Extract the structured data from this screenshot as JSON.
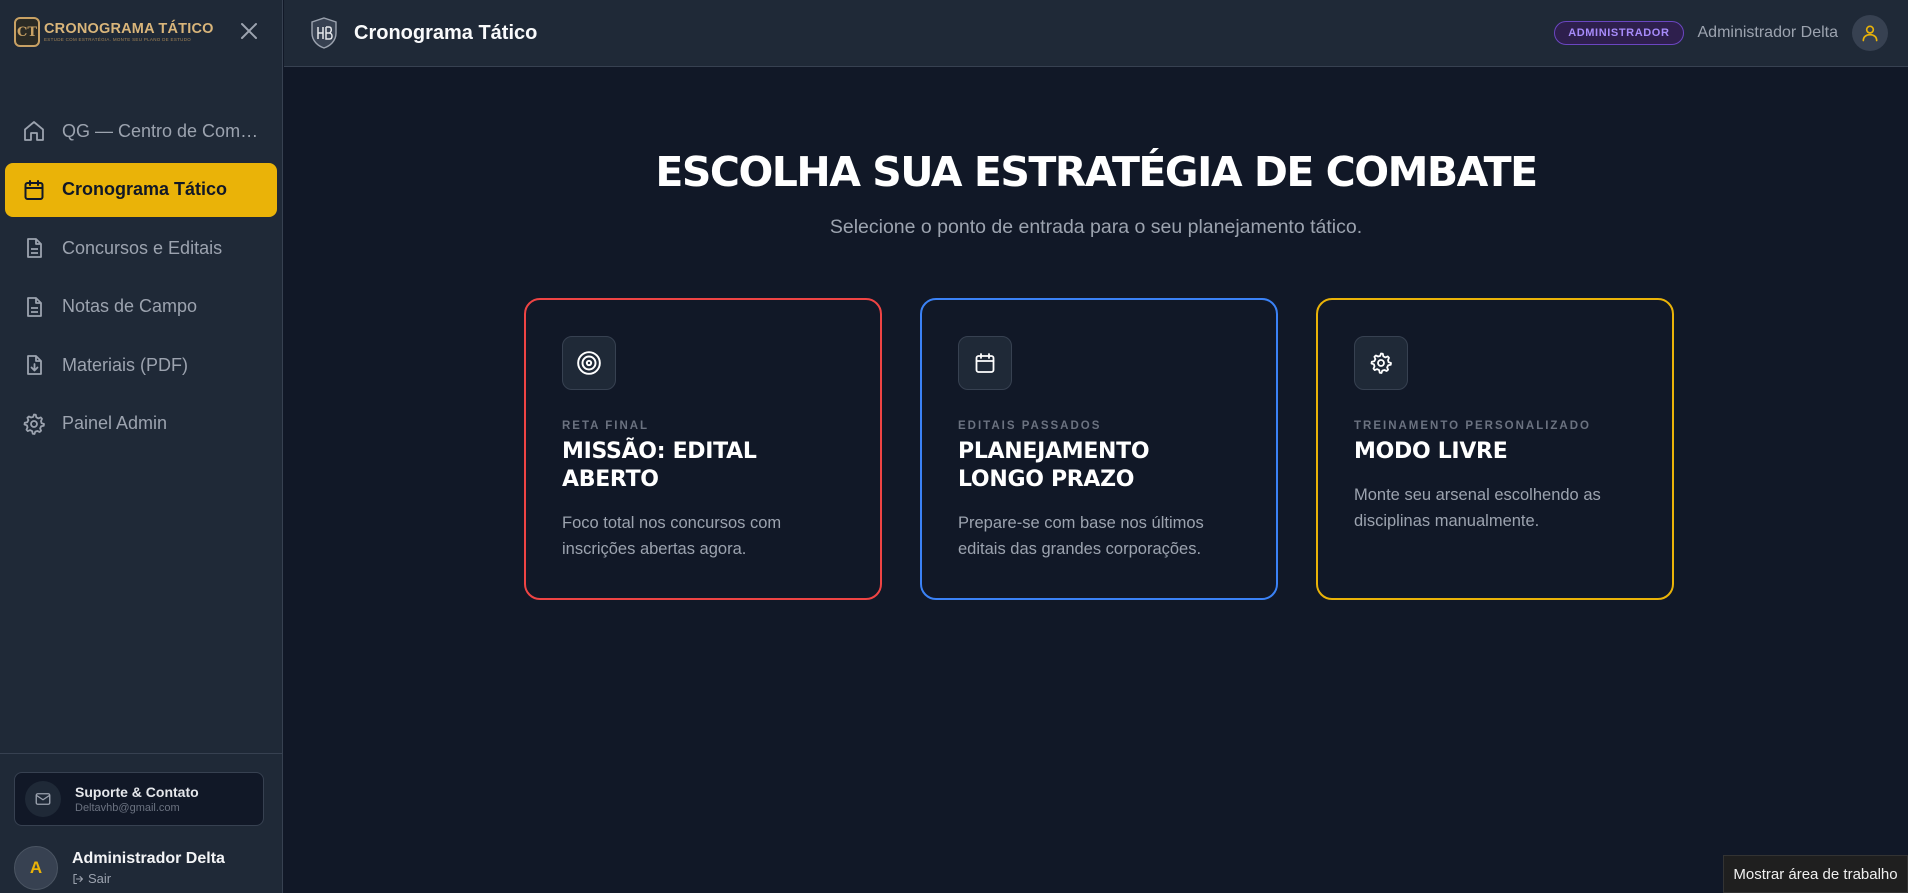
{
  "app": {
    "logo_initials": "CT",
    "logo_title": "CRONOGRAMA TÁTICO",
    "logo_subtitle": "ESTUDE COM ESTRATÉGIA. MONTE SEU PLANO DE ESTUDO"
  },
  "sidebar": {
    "items": [
      {
        "label": "QG — Centro de Comando",
        "icon": "home-icon",
        "active": false
      },
      {
        "label": "Cronograma Tático",
        "icon": "calendar-icon",
        "active": true
      },
      {
        "label": "Concursos e Editais",
        "icon": "document-icon",
        "active": false
      },
      {
        "label": "Notas de Campo",
        "icon": "document-icon",
        "active": false
      },
      {
        "label": "Materiais (PDF)",
        "icon": "file-download-icon",
        "active": false
      },
      {
        "label": "Painel Admin",
        "icon": "gear-icon",
        "active": false
      }
    ],
    "support": {
      "title": "Suporte & Contato",
      "email": "Deltavhb@gmail.com"
    },
    "user": {
      "initial": "A",
      "name": "Administrador Delta",
      "logout": "Sair"
    }
  },
  "header": {
    "title": "Cronograma Tático",
    "role_badge": "ADMINISTRADOR",
    "user_name": "Administrador Delta"
  },
  "main": {
    "title": "ESCOLHA SUA ESTRATÉGIA DE COMBATE",
    "subtitle": "Selecione o ponto de entrada para o seu planejamento tático.",
    "cards": [
      {
        "kicker": "RETA FINAL",
        "title": "MISSÃO: EDITAL ABERTO",
        "desc": "Foco total nos concursos com inscrições abertas agora.",
        "icon": "target-icon",
        "accent": "#ef4444"
      },
      {
        "kicker": "EDITAIS PASSADOS",
        "title": "PLANEJAMENTO LONGO PRAZO",
        "desc": "Prepare-se com base nos últimos editais das grandes corporações.",
        "icon": "calendar-icon",
        "accent": "#3b82f6"
      },
      {
        "kicker": "TREINAMENTO PERSONALIZADO",
        "title": "MODO LIVRE",
        "desc": "Monte seu arsenal escolhendo as disciplinas manualmente.",
        "icon": "gear-icon",
        "accent": "#eab308"
      }
    ]
  },
  "tooltip": "Mostrar área de trabalho",
  "colors": {
    "accent": "#eab308",
    "bg": "#111827",
    "panel": "#1f2937",
    "badge": "#a78bfa"
  }
}
